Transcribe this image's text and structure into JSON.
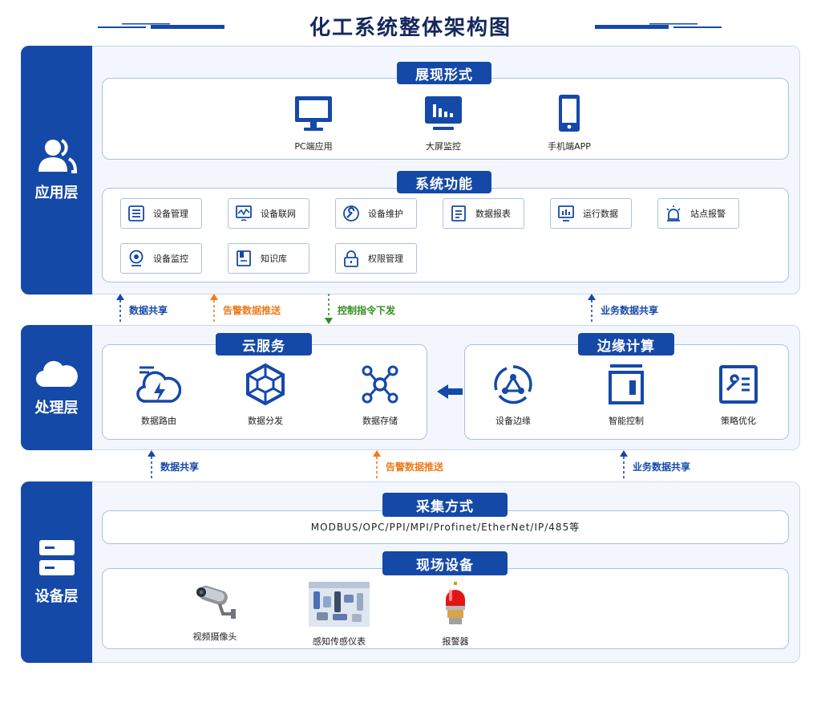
{
  "title": "化工系统整体架构图",
  "colors": {
    "primary": "#1549a8",
    "blue_flow": "#1549a8",
    "orange_flow": "#f07a1a",
    "green_flow": "#2f8f1f"
  },
  "app_layer": {
    "name": "应用层",
    "icon": "users-icon",
    "display": {
      "tag": "展现形式",
      "items": [
        {
          "label": "PC端应用",
          "icon": "monitor-icon"
        },
        {
          "label": "大屏监控",
          "icon": "dashboard-screen-icon"
        },
        {
          "label": "手机端APP",
          "icon": "smartphone-icon"
        }
      ]
    },
    "functions": {
      "tag": "系统功能",
      "items": [
        {
          "label": "设备管理",
          "icon": "list-icon"
        },
        {
          "label": "设备联网",
          "icon": "network-icon"
        },
        {
          "label": "设备维护",
          "icon": "wrench-icon"
        },
        {
          "label": "数据报表",
          "icon": "report-icon"
        },
        {
          "label": "运行数据",
          "icon": "chart-monitor-icon"
        },
        {
          "label": "站点报警",
          "icon": "alarm-icon"
        },
        {
          "label": "设备监控",
          "icon": "webcam-icon"
        },
        {
          "label": "知识库",
          "icon": "book-icon"
        },
        {
          "label": "权限管理",
          "icon": "lock-icon"
        }
      ]
    }
  },
  "flows_upper": [
    {
      "label": "数据共享",
      "direction": "up",
      "color": "blue"
    },
    {
      "label": "告警数据推送",
      "direction": "up",
      "color": "orange"
    },
    {
      "label": "控制指令下发",
      "direction": "down",
      "color": "green"
    },
    {
      "label": "业务数据共享",
      "direction": "up",
      "color": "blue"
    }
  ],
  "proc_layer": {
    "name": "处理层",
    "icon": "cloud-icon",
    "cloud": {
      "tag": "云服务",
      "items": [
        {
          "label": "数据路由",
          "icon": "cloud-lightning-icon"
        },
        {
          "label": "数据分发",
          "icon": "hexagon-network-icon"
        },
        {
          "label": "数据存储",
          "icon": "nodes-icon"
        }
      ]
    },
    "edge": {
      "tag": "边缘计算",
      "items": [
        {
          "label": "设备边缘",
          "icon": "edge-cycle-icon"
        },
        {
          "label": "智能控制",
          "icon": "control-panel-icon"
        },
        {
          "label": "策略优化",
          "icon": "strategy-icon"
        }
      ]
    }
  },
  "flows_lower": [
    {
      "label": "数据共享",
      "direction": "up",
      "color": "blue"
    },
    {
      "label": "告警数据推送",
      "direction": "up",
      "color": "orange"
    },
    {
      "label": "业务数据共享",
      "direction": "up",
      "color": "blue"
    }
  ],
  "device_layer": {
    "name": "设备层",
    "icon": "server-icon",
    "collect": {
      "tag": "采集方式",
      "protocols": "MODBUS/OPC/PPI/MPI/Profinet/EtherNet/IP/485等"
    },
    "field": {
      "tag": "现场设备",
      "items": [
        {
          "label": "视频摄像头",
          "icon": "camera-icon"
        },
        {
          "label": "感知传感仪表",
          "icon": "sensors-icon"
        },
        {
          "label": "报警器",
          "icon": "alarm-light-icon"
        }
      ]
    }
  }
}
